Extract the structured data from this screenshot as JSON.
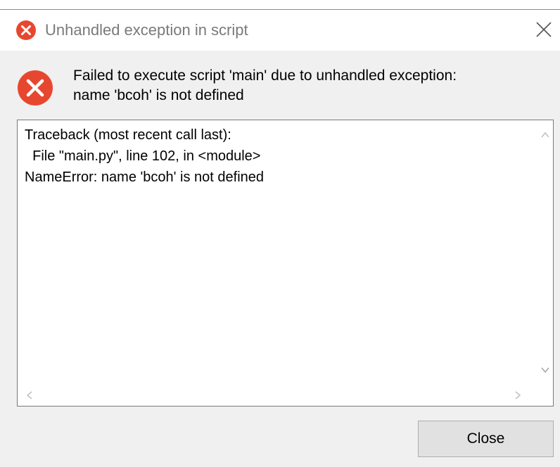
{
  "dialog": {
    "title": "Unhandled exception in script",
    "message_line1": "Failed to execute script 'main' due to unhandled exception:",
    "message_line2": "name 'bcoh' is not defined",
    "traceback": "Traceback (most recent call last):\n  File \"main.py\", line 102, in <module>\nNameError: name 'bcoh' is not defined",
    "close_button_label": "Close"
  },
  "icons": {
    "title_icon": "error-icon",
    "message_icon": "error-icon",
    "window_close": "close-icon",
    "scroll_up": "chevron-up-icon",
    "scroll_down": "chevron-down-icon",
    "scroll_left": "chevron-left-icon",
    "scroll_right": "chevron-right-icon"
  },
  "colors": {
    "error_red": "#e8472f",
    "dialog_background": "#f0f0f0",
    "button_background": "#e1e1e1"
  }
}
